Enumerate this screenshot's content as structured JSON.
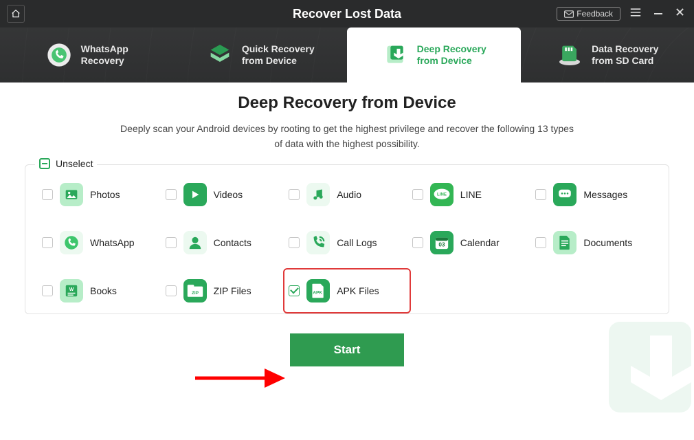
{
  "titlebar": {
    "title": "Recover Lost Data",
    "feedback_label": "Feedback"
  },
  "tabs": [
    {
      "line1": "WhatsApp",
      "line2": "Recovery"
    },
    {
      "line1": "Quick Recovery",
      "line2": "from Device"
    },
    {
      "line1": "Deep Recovery",
      "line2": "from Device"
    },
    {
      "line1": "Data Recovery",
      "line2": "from SD Card"
    }
  ],
  "page": {
    "heading": "Deep Recovery from Device",
    "subtitle": "Deeply scan your Android devices by rooting to get the highest privilege and recover the following 13 types of data with the highest possibility."
  },
  "panel": {
    "legend": "Unselect",
    "items": [
      {
        "label": "Photos",
        "checked": false
      },
      {
        "label": "Videos",
        "checked": false
      },
      {
        "label": "Audio",
        "checked": false
      },
      {
        "label": "LINE",
        "checked": false
      },
      {
        "label": "Messages",
        "checked": false
      },
      {
        "label": "WhatsApp",
        "checked": false
      },
      {
        "label": "Contacts",
        "checked": false
      },
      {
        "label": "Call Logs",
        "checked": false
      },
      {
        "label": "Calendar",
        "checked": false
      },
      {
        "label": "Documents",
        "checked": false
      },
      {
        "label": "Books",
        "checked": false
      },
      {
        "label": "ZIP Files",
        "checked": false
      },
      {
        "label": "APK Files",
        "checked": true,
        "highlighted": true
      }
    ]
  },
  "actions": {
    "start_label": "Start"
  },
  "colors": {
    "accent": "#2aa85a",
    "highlight_border": "#e03a3a"
  }
}
